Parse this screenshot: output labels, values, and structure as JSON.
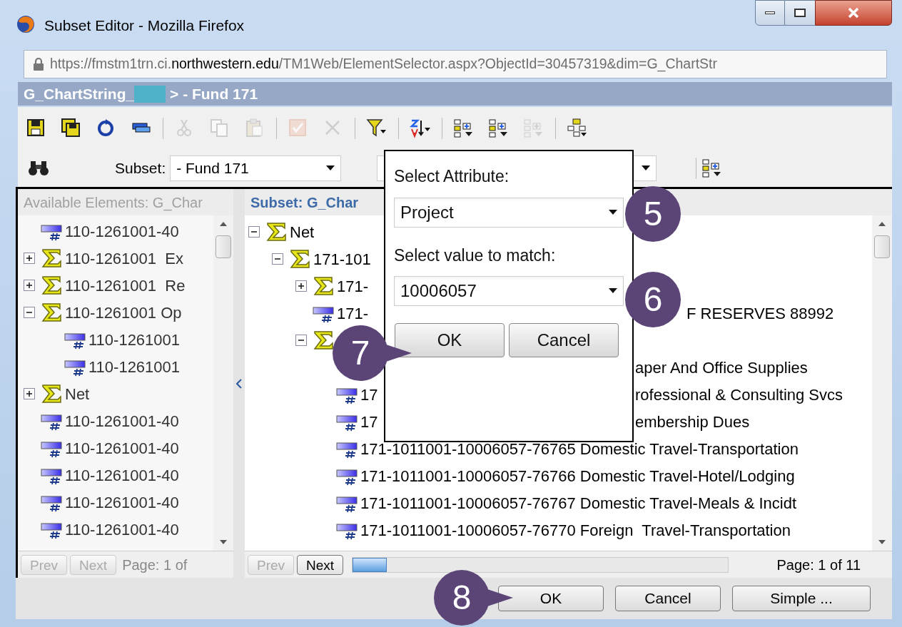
{
  "window": {
    "title": "Subset Editor - Mozilla Firefox"
  },
  "address_bar": {
    "url": "https://fmstm1trn.ci.**northwestern.edu**/TM1Web/ElementSelector.aspx?ObjectId=30457319&dim=G_ChartStr"
  },
  "header": {
    "title_start": "G_ChartString_",
    "title_end": "> - Fund 171"
  },
  "toolbar": {
    "groups": [
      [
        {
          "disabled": false
        },
        {
          "disabled": false
        },
        {
          "disabled": false
        },
        {
          "disabled": false
        }
      ],
      [
        {
          "disabled": true
        },
        {
          "disabled": true
        },
        {
          "disabled": true
        }
      ],
      [
        {
          "disabled": true
        },
        {
          "disabled": true
        }
      ],
      [
        {
          "disabled": false
        }
      ],
      [
        {
          "disabled": false
        }
      ],
      [
        {
          "disabled": false
        },
        {
          "disabled": false
        },
        {
          "disabled": true
        }
      ],
      [
        {
          "disabled": false
        }
      ]
    ]
  },
  "subset_row": {
    "label": "Subset:",
    "value": "- Fund 171"
  },
  "available_panel": {
    "title": "Available Elements: G_Char",
    "active": false,
    "tree": [
      {
        "kind": "leaf",
        "label": "110-1261001-40"
      },
      {
        "kind": "group",
        "expanded": false,
        "label": "110-1261001  Ex"
      },
      {
        "kind": "group",
        "expanded": false,
        "label": "110-1261001  Re"
      },
      {
        "kind": "group",
        "expanded": true,
        "label": "110-1261001 Op",
        "children": [
          {
            "kind": "leaf",
            "label": "110-1261001"
          },
          {
            "kind": "leaf",
            "label": "110-1261001"
          }
        ]
      },
      {
        "kind": "group",
        "expanded": false,
        "label": "Net"
      },
      {
        "kind": "leaf",
        "label": "110-1261001-40"
      },
      {
        "kind": "leaf",
        "label": "110-1261001-40"
      },
      {
        "kind": "leaf",
        "label": "110-1261001-40"
      },
      {
        "kind": "leaf",
        "label": "110-1261001-40"
      },
      {
        "kind": "leaf",
        "label": "110-1261001-40"
      }
    ],
    "prev": {
      "label": "Prev",
      "disabled": true
    },
    "next": {
      "label": "Next",
      "disabled": true
    },
    "page": "Page: 1 of"
  },
  "subset_panel": {
    "title": "Subset: G_Char",
    "active": true,
    "tree": [
      {
        "kind": "group",
        "expanded": true,
        "label": "Net",
        "children": [
          {
            "kind": "group",
            "expanded": true,
            "label": "171-101",
            "children": [
              {
                "kind": "group",
                "expanded": false,
                "label": "171-"
              },
              {
                "kind": "leaf",
                "label": "171-",
                "label_after": "F RESERVES 88992",
                "label_after_covered": true
              },
              {
                "kind": "group",
                "expanded": true,
                "children": [
                  {
                    "label_after": "aper And Office Supplies"
                  },
                  {
                    "kind": "leaf",
                    "label": "17",
                    "label_after": "rofessional & Consulting Svcs"
                  },
                  {
                    "kind": "leaf",
                    "label": "17",
                    "label_after": "embership Dues"
                  },
                  {
                    "kind": "leaf",
                    "label": "171-1011001-10006057-76765 Domestic Travel-Transportation"
                  },
                  {
                    "kind": "leaf",
                    "label": "171-1011001-10006057-76766 Domestic Travel-Hotel/Lodging"
                  },
                  {
                    "kind": "leaf",
                    "label": "171-1011001-10006057-76767 Domestic Travel-Meals & Incidt"
                  },
                  {
                    "kind": "leaf",
                    "label": "171-1011001-10006057-76770 Foreign  Travel-Transportation"
                  }
                ]
              }
            ]
          }
        ]
      }
    ],
    "prev": {
      "label": "Prev",
      "disabled": true
    },
    "next": {
      "label": "Next",
      "disabled": false
    },
    "page": "Page: 1 of 11"
  },
  "popup": {
    "attribute_label": "Select Attribute:",
    "attribute": "Project",
    "value_label": "Select value to match:",
    "value": "10006057",
    "ok": "OK",
    "cancel": "Cancel"
  },
  "callouts": [
    {
      "label": "5"
    },
    {
      "label": "6"
    },
    {
      "label": "7"
    },
    {
      "label": "8"
    }
  ],
  "buttons": [
    "OK",
    "Cancel",
    "Simple ..."
  ]
}
